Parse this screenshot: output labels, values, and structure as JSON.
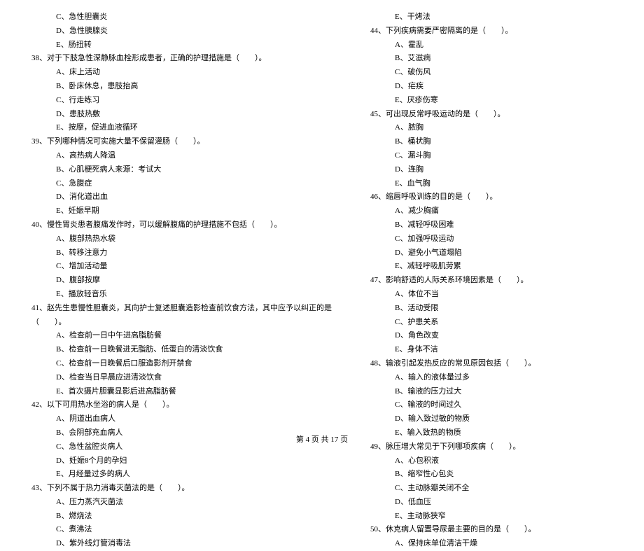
{
  "left": [
    {
      "type": "opt",
      "text": "C、急性胆囊炎"
    },
    {
      "type": "opt",
      "text": "D、急性胰腺炎"
    },
    {
      "type": "opt",
      "text": "E、肠扭转"
    },
    {
      "type": "q",
      "text": "38、对于下肢急性深静脉血栓形成患者，正确的护理措施是（　　）。"
    },
    {
      "type": "opt",
      "text": "A、床上活动"
    },
    {
      "type": "opt",
      "text": "B、卧床休息，患肢抬高"
    },
    {
      "type": "opt",
      "text": "C、行走练习"
    },
    {
      "type": "opt",
      "text": "D、患肢热敷"
    },
    {
      "type": "opt",
      "text": "E、按摩，促进血液循环"
    },
    {
      "type": "q",
      "text": "39、下列哪种情况可实施大量不保留灌肠（　　）。"
    },
    {
      "type": "opt",
      "text": "A、高热病人降温"
    },
    {
      "type": "opt",
      "text": "B、心肌梗死病人来源：考试大"
    },
    {
      "type": "opt",
      "text": "C、急腹症"
    },
    {
      "type": "opt",
      "text": "D、消化道出血"
    },
    {
      "type": "opt",
      "text": "E、妊娠早期"
    },
    {
      "type": "q",
      "text": "40、慢性胃炎患者腹痛发作时，可以缓解腹痛的护理措施不包括（　　）。"
    },
    {
      "type": "opt",
      "text": "A、腹部热热水袋"
    },
    {
      "type": "opt",
      "text": "B、转移注意力"
    },
    {
      "type": "opt",
      "text": "C、增加活动量"
    },
    {
      "type": "opt",
      "text": "D、腹部按摩"
    },
    {
      "type": "opt",
      "text": "E、播放轻音乐"
    },
    {
      "type": "q",
      "text": "41、赵先生患慢性胆囊炎，其向护士复述胆囊造影检查前饮食方法，其中应予以纠正的是"
    },
    {
      "type": "q2",
      "text": "（　　）。"
    },
    {
      "type": "opt",
      "text": "A、检查前一日中午进高脂肪餐"
    },
    {
      "type": "opt",
      "text": "B、检查前一日晚餐进无脂肪、低蛋白的清淡饮食"
    },
    {
      "type": "opt",
      "text": "C、检查前一日晚餐后口服造影剂开禁食"
    },
    {
      "type": "opt",
      "text": "D、检查当日早晨应进清淡饮食"
    },
    {
      "type": "opt",
      "text": "E、首次摄片胆囊显影后进高脂肪餐"
    },
    {
      "type": "q",
      "text": "42、以下可用热水坐浴的病人是（　　）。"
    },
    {
      "type": "opt",
      "text": "A、阴道出血病人"
    },
    {
      "type": "opt",
      "text": "B、会阴部充血病人"
    },
    {
      "type": "opt",
      "text": "C、急性盆腔炎病人"
    },
    {
      "type": "opt",
      "text": "D、妊娠8个月的孕妇"
    },
    {
      "type": "opt",
      "text": "E、月经量过多的病人"
    },
    {
      "type": "q",
      "text": "43、下列不属于热力消毒灭菌法的是（　　）。"
    },
    {
      "type": "opt",
      "text": "A、压力蒸汽灭菌法"
    },
    {
      "type": "opt",
      "text": "B、燃烧法"
    },
    {
      "type": "opt",
      "text": "C、煮沸法"
    },
    {
      "type": "opt",
      "text": "D、紫外线灯管消毒法"
    }
  ],
  "right": [
    {
      "type": "opt",
      "text": "E、干烤法"
    },
    {
      "type": "q",
      "text": "44、下列疾病需要严密隔离的是（　　）。"
    },
    {
      "type": "opt",
      "text": "A、霍乱"
    },
    {
      "type": "opt",
      "text": "B、艾滋病"
    },
    {
      "type": "opt",
      "text": "C、破伤风"
    },
    {
      "type": "opt",
      "text": "D、疟疾"
    },
    {
      "type": "opt",
      "text": "E、厌疹伤寒"
    },
    {
      "type": "q",
      "text": "45、可出现反常呼吸运动的是（　　）。"
    },
    {
      "type": "opt",
      "text": "A、脓胸"
    },
    {
      "type": "opt",
      "text": "B、桶状胸"
    },
    {
      "type": "opt",
      "text": "C、漏斗胸"
    },
    {
      "type": "opt",
      "text": "D、连胸"
    },
    {
      "type": "opt",
      "text": "E、血气胸"
    },
    {
      "type": "q",
      "text": "46、缩唇呼吸训练的目的是（　　）。"
    },
    {
      "type": "opt",
      "text": "A、减少胸痛"
    },
    {
      "type": "opt",
      "text": "B、减轻呼吸困难"
    },
    {
      "type": "opt",
      "text": "C、加强呼吸运动"
    },
    {
      "type": "opt",
      "text": "D、避免小气道塌陷"
    },
    {
      "type": "opt",
      "text": "E、减轻呼吸肌劳累"
    },
    {
      "type": "q",
      "text": "47、影响舒适的人际关系环境因素是（　　）。"
    },
    {
      "type": "opt",
      "text": "A、体位不当"
    },
    {
      "type": "opt",
      "text": "B、活动受限"
    },
    {
      "type": "opt",
      "text": "C、护患关系"
    },
    {
      "type": "opt",
      "text": "D、角色改变"
    },
    {
      "type": "opt",
      "text": "E、身体不洁"
    },
    {
      "type": "q",
      "text": "48、输液引起发热反应的常见原因包括（　　）。"
    },
    {
      "type": "opt",
      "text": "A、输入的液体量过多"
    },
    {
      "type": "opt",
      "text": "B、输液的压力过大"
    },
    {
      "type": "opt",
      "text": "C、输液的时间过久"
    },
    {
      "type": "opt",
      "text": "D、输入致过敏的物质"
    },
    {
      "type": "opt",
      "text": "E、输入致热的物质"
    },
    {
      "type": "q",
      "text": "49、脉压增大常见于下列哪项疾病（　　）。"
    },
    {
      "type": "opt",
      "text": "A、心包积液"
    },
    {
      "type": "opt",
      "text": "B、缩窄性心包炎"
    },
    {
      "type": "opt",
      "text": "C、主动脉瓣关闭不全"
    },
    {
      "type": "opt",
      "text": "D、低血压"
    },
    {
      "type": "opt",
      "text": "E、主动脉狭窄"
    },
    {
      "type": "q",
      "text": "50、休克病人留置导尿最主要的目的是（　　）。"
    },
    {
      "type": "opt",
      "text": "A、保持床单位清洁干燥"
    }
  ],
  "footer": "第 4 页 共 17 页"
}
